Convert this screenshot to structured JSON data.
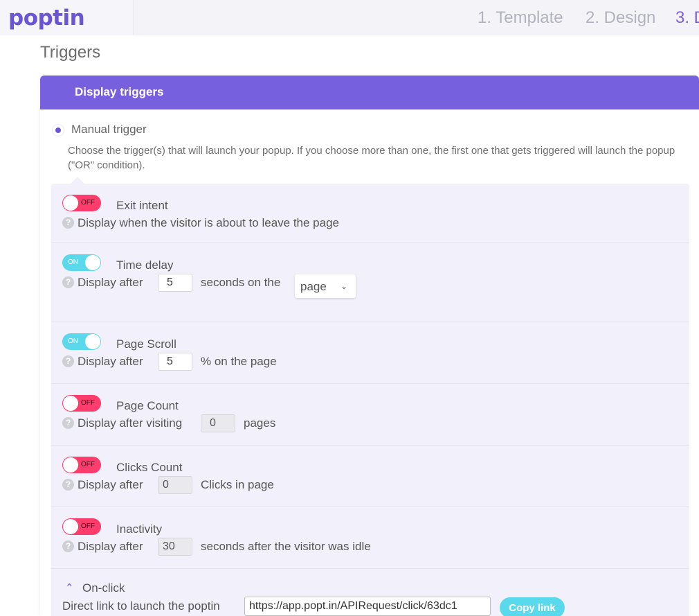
{
  "brand": {
    "logo_text": "poptin",
    "accent": "#7760dd"
  },
  "steps": [
    {
      "label": "1. Template"
    },
    {
      "label": "2. Design"
    },
    {
      "label": "3. D"
    }
  ],
  "page_title": "Triggers",
  "panel": {
    "header": "Display triggers",
    "radio_label": "Manual trigger",
    "description": "Choose the trigger(s) that will launch your popup. If you choose more than one, the first one that gets triggered will launch the popup (\"OR\" condition)."
  },
  "triggers": {
    "exit_intent": {
      "toggle": "OFF",
      "title": "Exit intent",
      "text": "Display when the visitor is about to leave the page"
    },
    "time_delay": {
      "toggle": "ON",
      "title": "Time delay",
      "pre": "Display after",
      "value": "5",
      "post": "seconds on the",
      "select": "page"
    },
    "page_scroll": {
      "toggle": "ON",
      "title": "Page Scroll",
      "pre": "Display after",
      "value": "5",
      "post": "% on the page"
    },
    "page_count": {
      "toggle": "OFF",
      "title": "Page Count",
      "pre": "Display after visiting",
      "value": "0",
      "post": "pages"
    },
    "clicks_count": {
      "toggle": "OFF",
      "title": "Clicks Count",
      "pre": "Display after",
      "value": "0",
      "post": "Clicks in page"
    },
    "inactivity": {
      "toggle": "OFF",
      "title": "Inactivity",
      "pre": "Display after",
      "value": "30",
      "post": "seconds after the visitor was idle"
    }
  },
  "onclick": {
    "title": "On-click",
    "link_label": "Direct link to launch the poptin",
    "link_value": "https://app.popt.in/APIRequest/click/63dc1",
    "copy_label": "Copy link"
  },
  "help_glyph": "?"
}
